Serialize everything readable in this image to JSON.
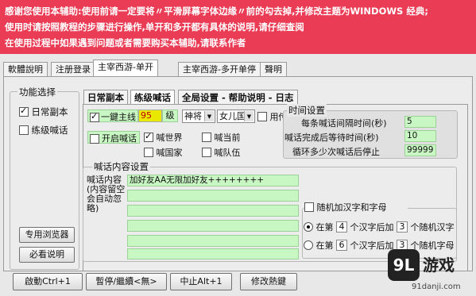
{
  "notice": {
    "line1": "感谢您使用本辅助:使用前请一定要将〃平滑屏幕字体边缘〃前的勾去掉,并修改主题为WINDOWS 经典;",
    "line2": "使用时请按照教程的步骤进行操作,单开和多开都有具体的说明,请仔细查阅",
    "line3": "在使用过程中如果遇到问题或者需要购买本辅助,请联系作者"
  },
  "tabs": [
    {
      "label": "軟體說明"
    },
    {
      "label": "注册登录"
    },
    {
      "label": "主宰西游-单开"
    },
    {
      "label": "主宰西游-多开单停"
    },
    {
      "label": "聲明"
    }
  ],
  "func_group": {
    "title": "功能选择",
    "daily": {
      "label": "日常副本",
      "checked": true
    },
    "shout": {
      "label": "练级喊话",
      "checked": false
    },
    "browser_btn": "专用浏览器",
    "readme_btn": "必看说明"
  },
  "subtabs": [
    {
      "label": "日常副本"
    },
    {
      "label": "练级喊话"
    },
    {
      "label": "全局设置 - 帮助说明 - 日志"
    }
  ],
  "quest": {
    "main_line_label": "一鍵主线",
    "main_line_checked": true,
    "level_value": "95",
    "level_unit": "级",
    "role_select": "神将",
    "gender_select": "女儿国",
    "use_transfer_label": "用传送",
    "use_transfer_checked": false
  },
  "shout_opts": {
    "open_shout": {
      "label": "开启喊话",
      "checked": false
    },
    "world": {
      "label": "喊世界",
      "checked": true
    },
    "current": {
      "label": "喊当前",
      "checked": false
    },
    "country": {
      "label": "喊国家",
      "checked": false
    },
    "team": {
      "label": "喊队伍",
      "checked": false
    }
  },
  "timing": {
    "title": "时间设置",
    "interval_label": "每条喊话间隔时间(秒)",
    "interval_value": "5",
    "wait_label": "喊话完成后等待时间(秒)",
    "wait_value": "10",
    "loop_label": "循环多少次喊话后停止",
    "loop_value": "99999"
  },
  "content": {
    "title": "喊话内容设置",
    "text_label": "喊话内容(内容留空会自动忽略)",
    "line1": "加好友AA无限加好友++++++++"
  },
  "random": {
    "enable_label": "随机加汉字和字母",
    "enable_checked": false,
    "opt1_pre": "在第",
    "opt1_n": "4",
    "opt1_mid": "个汉字后加",
    "opt1_m": "3",
    "opt1_post": "个随机汉字",
    "opt1_selected": true,
    "opt2_pre": "在第",
    "opt2_n": "6",
    "opt2_mid": "个汉字后加",
    "opt2_m": "3",
    "opt2_post": "个随机字母",
    "opt2_selected": false
  },
  "bottom": {
    "start": "啟動Ctrl+1",
    "pause": "暫停/繼續<無>",
    "stop": "中止Alt+1",
    "hotkey": "修改熱鍵"
  },
  "logo": {
    "badge": "9L",
    "name": "游戏",
    "url": "91danji.com"
  }
}
